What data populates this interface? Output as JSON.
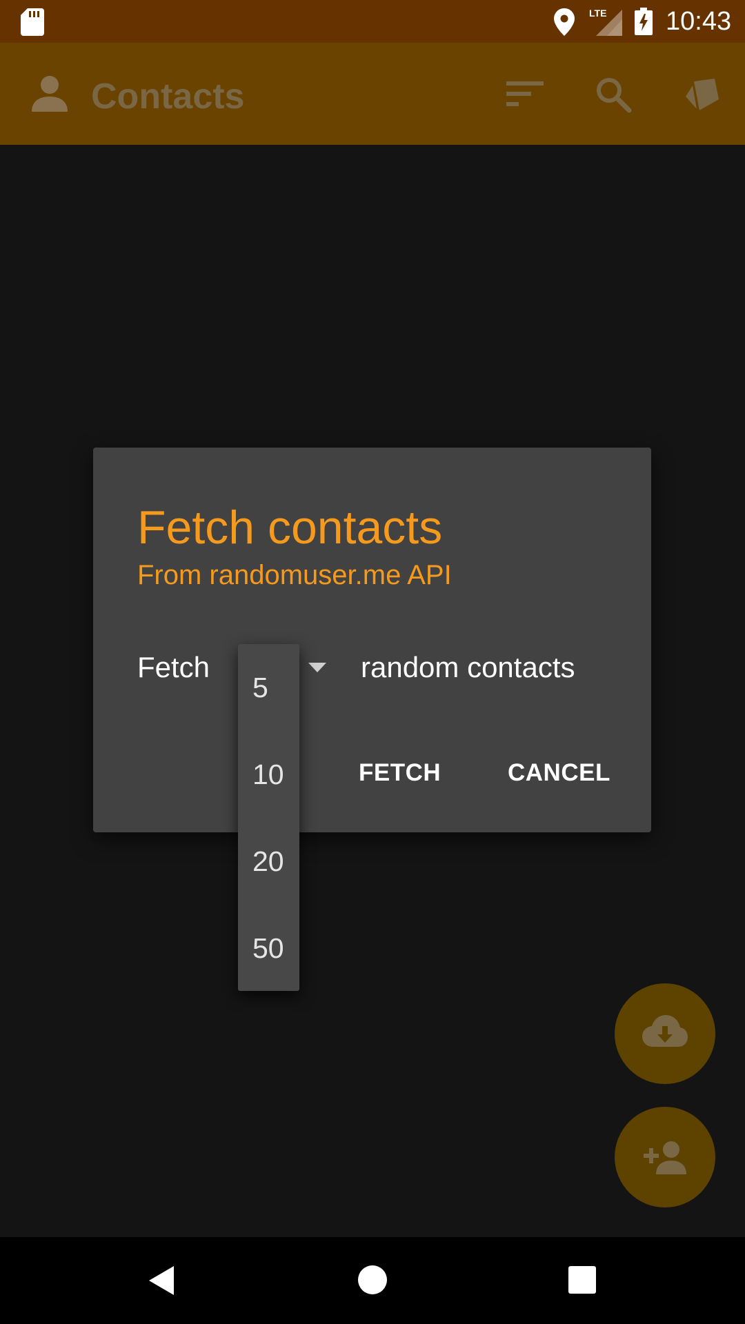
{
  "status_bar": {
    "time": "10:43",
    "icons": [
      "sd-card-icon",
      "location-icon",
      "lte-signal-icon",
      "battery-charging-icon"
    ]
  },
  "app_bar": {
    "title": "Contacts",
    "icons": [
      "person-icon",
      "sort-icon",
      "search-icon",
      "tag-icon"
    ]
  },
  "dialog": {
    "title": "Fetch contacts",
    "subtitle": "From randomuser.me API",
    "fetch_label": "Fetch",
    "random_label": "random contacts",
    "fetch_button": "FETCH",
    "cancel_button": "CANCEL"
  },
  "dropdown": {
    "options": [
      "5",
      "10",
      "20",
      "50"
    ]
  },
  "fabs": {
    "download_icon": "cloud-download-icon",
    "add_contact_icon": "add-person-icon"
  },
  "nav_bar": {
    "icons": [
      "back-icon",
      "home-icon",
      "recents-icon"
    ]
  },
  "colors": {
    "accent": "#f59a1d",
    "status_bar": "#663300",
    "app_bar": "#6a4300",
    "dialog_bg": "#424242",
    "fab": "#5e4300"
  }
}
